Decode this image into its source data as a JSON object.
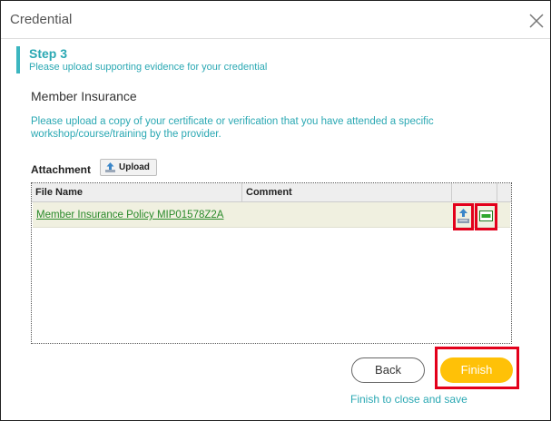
{
  "dialog": {
    "title": "Credential",
    "close_icon": "close-icon"
  },
  "step": {
    "title": "Step 3",
    "description": "Please upload supporting evidence for your credential"
  },
  "section": {
    "title": "Member Insurance",
    "instructions": "Please upload a copy of your certificate or verification that you have attended a specific workshop/course/training by the provider."
  },
  "attachment": {
    "label": "Attachment",
    "upload_label": "Upload",
    "upload_icon": "upload-icon"
  },
  "table": {
    "columns": [
      "File Name",
      "Comment"
    ],
    "rows": [
      {
        "file_name": "Member Insurance Policy MIP01578Z2A",
        "comment": "",
        "actions": [
          "download-icon",
          "view-icon"
        ]
      }
    ]
  },
  "footer": {
    "back_label": "Back",
    "finish_label": "Finish",
    "note": "Finish to close and save"
  },
  "colors": {
    "accent": "#2aa8b3",
    "finish": "#ffc107",
    "highlight": "#e3001b",
    "link": "#2a8a2a"
  }
}
